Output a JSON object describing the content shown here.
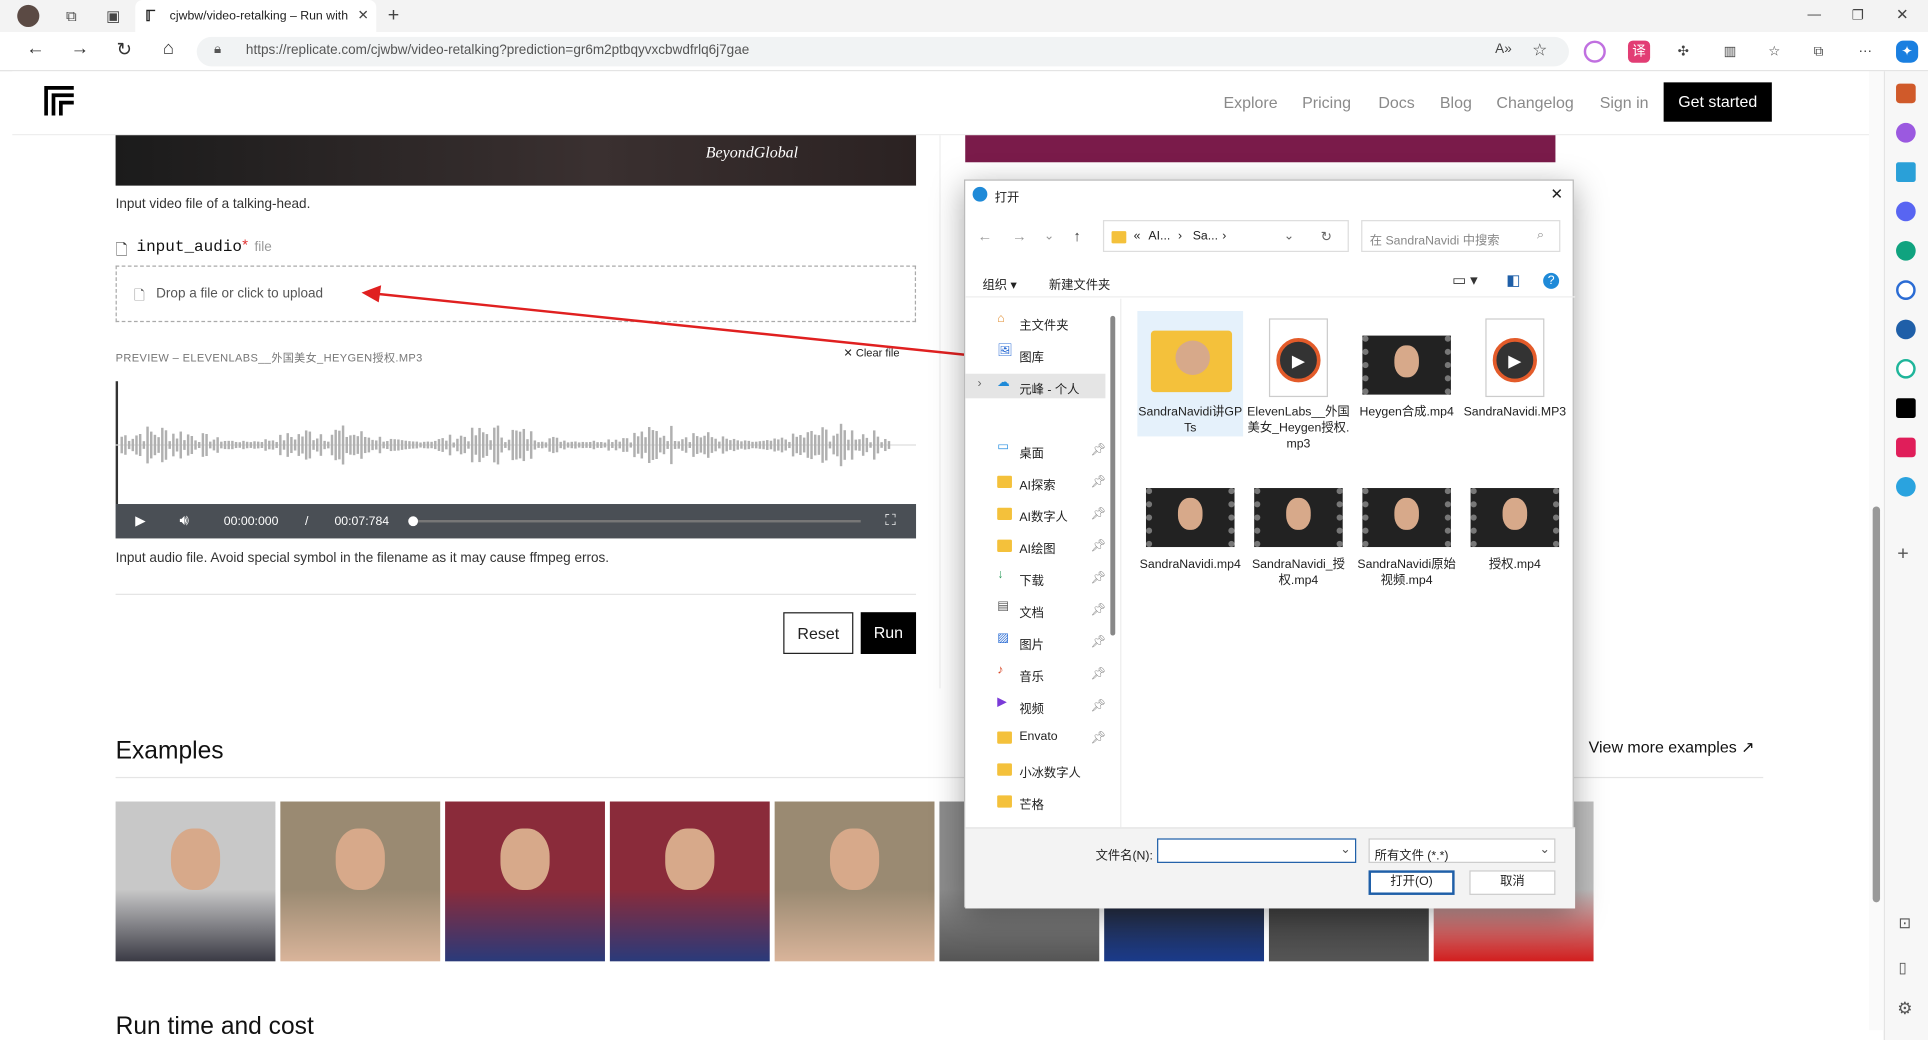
{
  "browser": {
    "tab_title": "cjwbw/video-retalking – Run with",
    "url": "https://replicate.com/cjwbw/video-retalking?prediction=gr6m2ptbqyvxcbwdfrlq6j7gae",
    "close_label": "✕",
    "new_tab_label": "+"
  },
  "header": {
    "nav": [
      "Explore",
      "Pricing",
      "Docs",
      "Blog",
      "Changelog",
      "Sign in"
    ],
    "cta": "Get started"
  },
  "form": {
    "video_caption_brand": "BeyondGlobal",
    "video_help": "Input video file of a talking-head.",
    "audio_field_name": "input_audio",
    "audio_required": "*",
    "audio_field_type": "file",
    "drop_label": "Drop a file or click to upload",
    "preview_label": "PREVIEW – ELEVENLABS__外国美女_HEYGEN授权.MP3",
    "clear_label": "Clear file",
    "time_current": "00:00:000",
    "time_sep": "/",
    "time_total": "00:07:784",
    "audio_help": "Input audio file. Avoid special symbol in the filename as it may cause ffmpeg erros.",
    "reset_label": "Reset",
    "run_label": "Run"
  },
  "examples": {
    "title": "Examples",
    "more_label": "View more examples ↗",
    "next_heading": "Run time and cost"
  },
  "dialog": {
    "title": "打开",
    "breadcrumb": [
      "«",
      "AI...",
      "›",
      "Sa...",
      "›"
    ],
    "search_placeholder": "在 SandraNavidi 中搜索",
    "organize": "组织 ▾",
    "new_folder": "新建文件夹",
    "nav_items": [
      {
        "label": "主文件夹",
        "pinned": false
      },
      {
        "label": "图库",
        "pinned": false
      },
      {
        "label": "元峰 - 个人",
        "pinned": false
      },
      {
        "label": "桌面",
        "pinned": true
      },
      {
        "label": "AI探索",
        "pinned": true
      },
      {
        "label": "AI数字人",
        "pinned": true
      },
      {
        "label": "AI绘图",
        "pinned": true
      },
      {
        "label": "下载",
        "pinned": true
      },
      {
        "label": "文档",
        "pinned": true
      },
      {
        "label": "图片",
        "pinned": true
      },
      {
        "label": "音乐",
        "pinned": true
      },
      {
        "label": "视频",
        "pinned": true
      },
      {
        "label": "Envato",
        "pinned": true
      },
      {
        "label": "小冰数字人",
        "pinned": false
      },
      {
        "label": "芒格",
        "pinned": false
      }
    ],
    "files": [
      {
        "name": "SandraNavidi讲GPTs",
        "kind": "folder"
      },
      {
        "name": "ElevenLabs__外国美女_Heygen授权.mp3",
        "kind": "audio"
      },
      {
        "name": "Heygen合成.mp4",
        "kind": "video"
      },
      {
        "name": "SandraNavidi.MP3",
        "kind": "audio"
      },
      {
        "name": "SandraNavidi.mp4",
        "kind": "video"
      },
      {
        "name": "SandraNavidi_授权.mp4",
        "kind": "video"
      },
      {
        "name": "SandraNavidi原始视频.mp4",
        "kind": "video"
      },
      {
        "name": "授权.mp4",
        "kind": "video"
      }
    ],
    "filename_label": "文件名(N):",
    "filename_value": "",
    "filetype": "所有文件 (*.*)",
    "open_label": "打开(O)",
    "cancel_label": "取消"
  }
}
